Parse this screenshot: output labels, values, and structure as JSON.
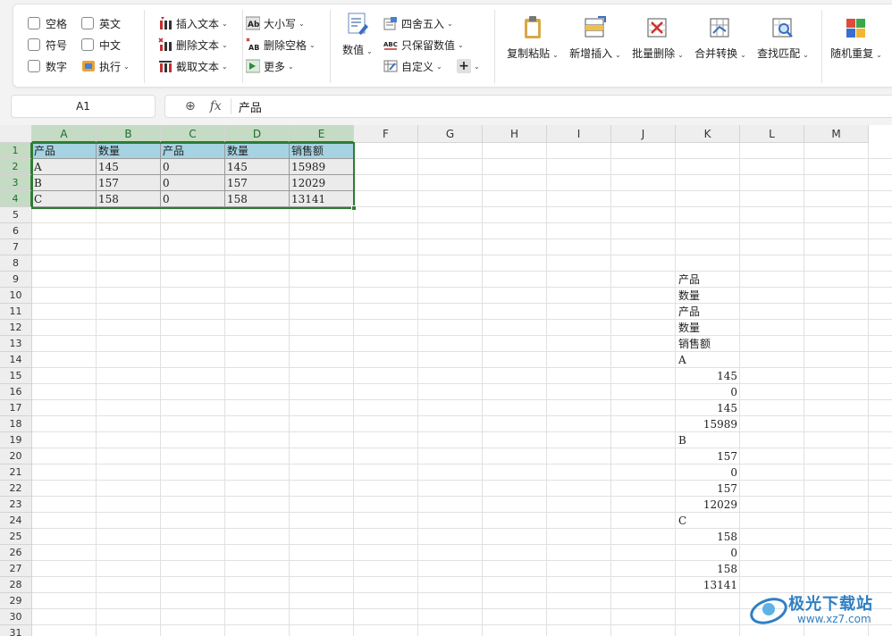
{
  "ribbon": {
    "checkboxes": [
      {
        "label": "空格",
        "checked": false
      },
      {
        "label": "英文",
        "checked": false
      },
      {
        "label": "符号",
        "checked": false
      },
      {
        "label": "中文",
        "checked": false
      },
      {
        "label": "数字",
        "checked": false
      }
    ],
    "execute_label": "执行",
    "text_tools": {
      "insert": "插入文本",
      "delete": "删除文本",
      "extract": "截取文本"
    },
    "case_tools": {
      "case": "大小写",
      "remove_space": "删除空格",
      "more": "更多"
    },
    "number_tools": {
      "value": "数值",
      "round": "四舍五入",
      "keep_values": "只保留数值",
      "custom": "自定义"
    },
    "big_buttons": {
      "copy_paste": "复制粘贴",
      "insert_new": "新增插入",
      "batch_delete": "批量删除",
      "merge_convert": "合并转换",
      "find_match": "查找匹配",
      "random_repeat": "随机重复"
    }
  },
  "formula_bar": {
    "cell_ref": "A1",
    "fx": "fx",
    "value": "产品"
  },
  "sheet": {
    "columns": [
      "A",
      "B",
      "C",
      "D",
      "E",
      "F",
      "G",
      "H",
      "I",
      "J",
      "K",
      "L",
      "M"
    ],
    "selected_columns": [
      "A",
      "B",
      "C",
      "D",
      "E"
    ],
    "rows": [
      "1",
      "2",
      "3",
      "4",
      "5",
      "6",
      "7",
      "8",
      "9",
      "10",
      "11",
      "12",
      "13",
      "14",
      "15",
      "16",
      "17",
      "18",
      "19",
      "20",
      "21",
      "22",
      "23",
      "24",
      "25",
      "26",
      "27",
      "28",
      "29",
      "30",
      "31"
    ],
    "selected_rows": [
      "1",
      "2",
      "3",
      "4"
    ],
    "table_header": [
      "产品",
      "数量",
      "产品",
      "数量",
      "销售额"
    ],
    "table_rows": [
      [
        "A",
        "145",
        "0",
        "145",
        "15989"
      ],
      [
        "B",
        "157",
        "0",
        "157",
        "12029"
      ],
      [
        "C",
        "158",
        "0",
        "158",
        "13141"
      ]
    ],
    "column_k_values": [
      "产品",
      "数量",
      "产品",
      "数量",
      "销售额",
      "A",
      "145",
      "0",
      "145",
      "15989",
      "B",
      "157",
      "0",
      "157",
      "12029",
      "C",
      "158",
      "0",
      "158",
      "13141"
    ]
  },
  "watermark": {
    "name": "极光下载站",
    "url": "www.xz7.com"
  }
}
